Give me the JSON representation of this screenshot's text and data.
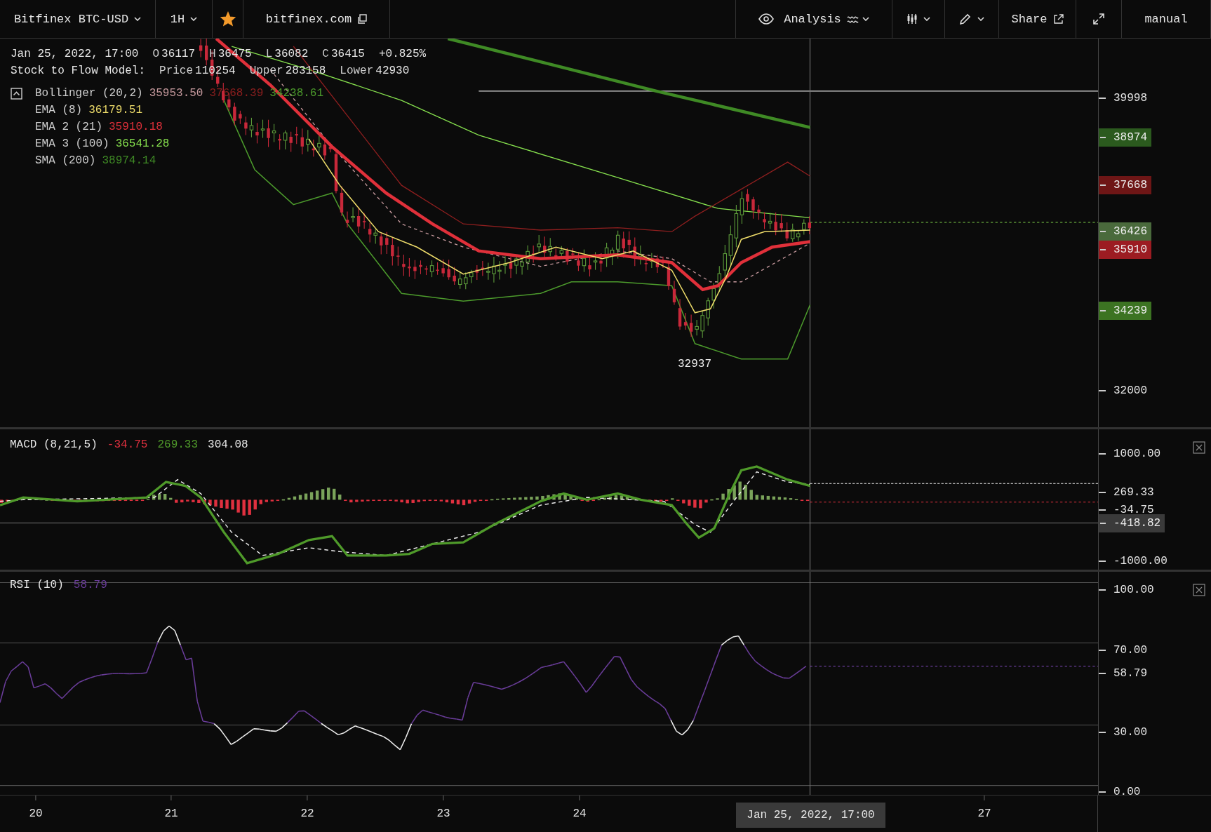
{
  "toolbar": {
    "symbol": "Bitfinex BTC-USD",
    "interval": "1H",
    "starred": true,
    "exchange_link": "bitfinex.com",
    "analysis_label": "Analysis",
    "share_label": "Share",
    "mode": "manual"
  },
  "ohlc": {
    "date": "Jan 25, 2022, 17:00",
    "fields": [
      {
        "label": "O",
        "value": "36117"
      },
      {
        "label": "H",
        "value": "36475"
      },
      {
        "label": "L",
        "value": "36082"
      },
      {
        "label": "C",
        "value": "36415"
      }
    ],
    "change": "+0.825%"
  },
  "stock_to_flow": {
    "title": "Stock to Flow Model:",
    "fields": [
      {
        "label": "Price",
        "value": "110254"
      },
      {
        "label": "Upper",
        "value": "283158"
      },
      {
        "label": "Lower",
        "value": "42930"
      }
    ]
  },
  "indicators": {
    "expanded": true,
    "items": [
      {
        "name": "Bollinger (20,2)",
        "values": [
          {
            "text": "35953.50",
            "color": "#c79a9e"
          },
          {
            "text": "37668.39",
            "color": "#8e1f1f"
          },
          {
            "text": "34238.61",
            "color": "#4c9a2c"
          }
        ]
      },
      {
        "name": "EMA (8)",
        "values": [
          {
            "text": "36179.51",
            "color": "#eedc6a"
          }
        ]
      },
      {
        "name": "EMA 2 (21)",
        "values": [
          {
            "text": "35910.18",
            "color": "#e0303a"
          }
        ]
      },
      {
        "name": "EMA 3 (100)",
        "values": [
          {
            "text": "36541.28",
            "color": "#86e04e"
          }
        ]
      },
      {
        "name": "SMA (200)",
        "values": [
          {
            "text": "38974.14",
            "color": "#3f8a25"
          }
        ]
      }
    ]
  },
  "price_axis": {
    "ticks": [
      "39998",
      "32000"
    ],
    "tags": [
      {
        "text": "38974",
        "color": "#2b5a1e"
      },
      {
        "text": "37668",
        "color": "#6e1616"
      },
      {
        "text": "36426",
        "color": "#4a6a3c"
      },
      {
        "text": "35910",
        "color": "#9c1c22"
      },
      {
        "text": "34239",
        "color": "#3c7322"
      }
    ]
  },
  "low_marker": "32937",
  "macd": {
    "title": "MACD (8,21,5)",
    "values": [
      {
        "text": "-34.75",
        "color": "#e0303f"
      },
      {
        "text": "269.33",
        "color": "#4f9a2a"
      },
      {
        "text": "304.08",
        "color": "#e6e6e6"
      }
    ],
    "axis": [
      "1000.00",
      "269.33",
      "-34.75",
      "-1000.00"
    ],
    "crosshair_value": "-418.82"
  },
  "rsi": {
    "title": "RSI (10)",
    "value": "58.79",
    "axis": [
      "100.00",
      "70.00",
      "58.79",
      "30.00",
      "0.00"
    ]
  },
  "time_axis": {
    "ticks": [
      "20",
      "21",
      "22",
      "23",
      "24",
      "27"
    ],
    "crosshair_time": "Jan 25, 2022, 17:00"
  }
}
